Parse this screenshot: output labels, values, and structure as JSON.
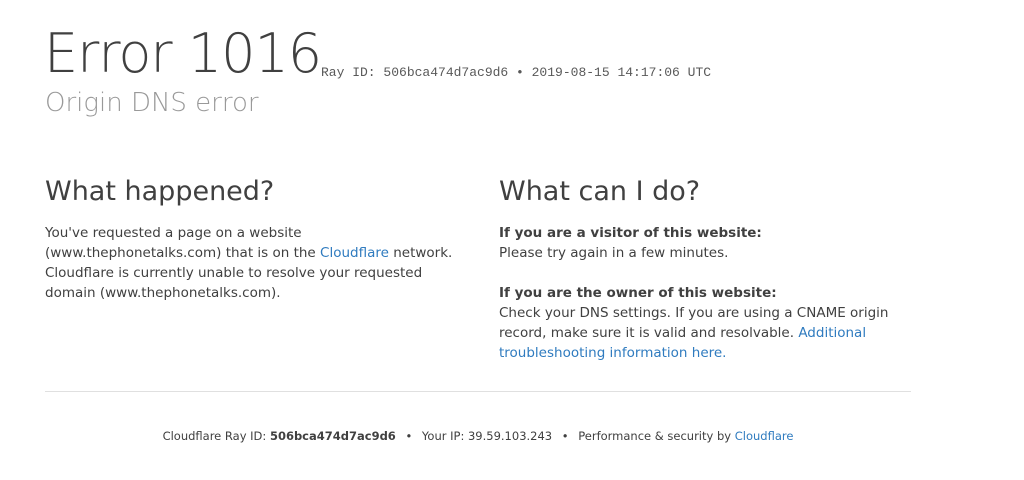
{
  "header": {
    "title": "Error 1016",
    "ray_line": "Ray ID: 506bca474d7ac9d6 • 2019-08-15 14:17:06 UTC",
    "subtitle": "Origin DNS error"
  },
  "what_happened": {
    "heading": "What happened?",
    "text_1": "You've requested a page on a website (www.thephonetalks.com) that is on the ",
    "link": "Cloudflare",
    "text_2": " network. Cloudflare is currently unable to resolve your requested domain (www.thephonetalks.com)."
  },
  "what_can_i_do": {
    "heading": "What can I do?",
    "visitor_label": "If you are a visitor of this website:",
    "visitor_text": "Please try again in a few minutes.",
    "owner_label": "If you are the owner of this website:",
    "owner_text": "Check your DNS settings. If you are using a CNAME origin record, make sure it is valid and resolvable. ",
    "owner_link": "Additional troubleshooting information here."
  },
  "footer": {
    "ray_label": "Cloudflare Ray ID: ",
    "ray_id": "506bca474d7ac9d6",
    "sep": "•",
    "ip_label": "Your IP: 39.59.103.243",
    "perf_label": "Performance & security by ",
    "perf_link": "Cloudflare"
  },
  "colors": {
    "link": "#2f7bbf",
    "text": "#404040",
    "muted": "#999999"
  }
}
